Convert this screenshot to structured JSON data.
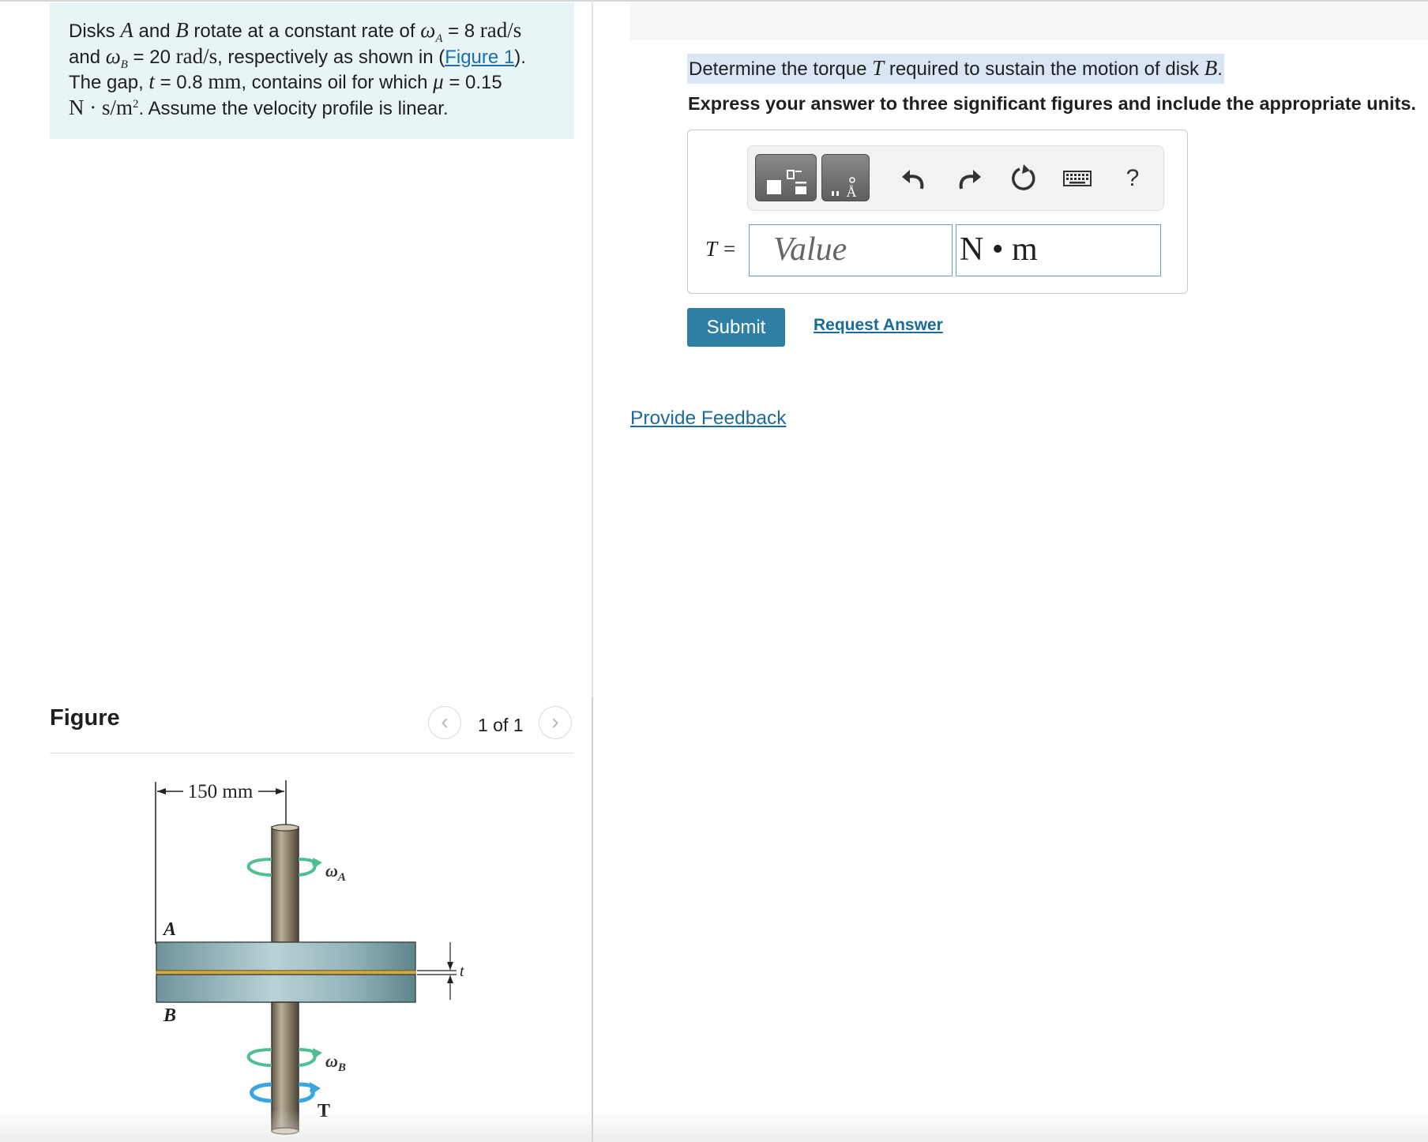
{
  "problem": {
    "t1": "Disks ",
    "A": "A",
    "t2": " and ",
    "B": "B",
    "t3": " rotate at a constant rate of ",
    "omega": "ω",
    "subA": "A",
    "t4": " = 8 ",
    "rad_s_1": "rad/s",
    "t5": "and ",
    "subB": "B",
    "t6": " = 20 ",
    "rad_s_2": "rad/s",
    "t7": ", respectively as shown in (",
    "figure_link": "Figure 1",
    "t8": ").",
    "t9": "The gap, ",
    "t_var": "t",
    "t10": " = 0.8 ",
    "mm": "mm",
    "t11": ", contains oil for which ",
    "mu": "μ",
    "t12": " = 0.15",
    "unit_N": "N · s/m",
    "sup2": "2",
    "t13": ". Assume the velocity profile is linear."
  },
  "figure": {
    "title": "Figure",
    "pager": "1 of 1",
    "prev_icon": "chevron-left-icon",
    "next_icon": "chevron-right-icon",
    "dim_label": "150 mm",
    "label_A": "A",
    "label_B": "B",
    "label_omegaA": "ω",
    "label_omegaA_sub": "A",
    "label_omegaB": "ω",
    "label_omegaB_sub": "B",
    "label_T": "T",
    "label_t": "t"
  },
  "question": {
    "q1": "Determine the torque ",
    "T": "T",
    "q2": " required to sustain the motion of disk ",
    "B": "B",
    "q3": ".",
    "instruction": "Express your answer to three significant figures and include the appropriate units."
  },
  "answer": {
    "label": "T =",
    "value_placeholder": "Value",
    "units": "N • m",
    "toolbar_icons": [
      "templates-icon",
      "units-icon",
      "undo-icon",
      "redo-icon",
      "reset-icon",
      "keyboard-icon",
      "help-icon"
    ],
    "help_glyph": "?"
  },
  "actions": {
    "submit": "Submit",
    "request_answer": "Request Answer",
    "provide_feedback": "Provide Feedback"
  },
  "colors": {
    "statement_bg": "#e9f4f7",
    "link": "#1b6b9b",
    "submit_bg": "#2e7fa3",
    "highlight": "#dbe6f5"
  }
}
